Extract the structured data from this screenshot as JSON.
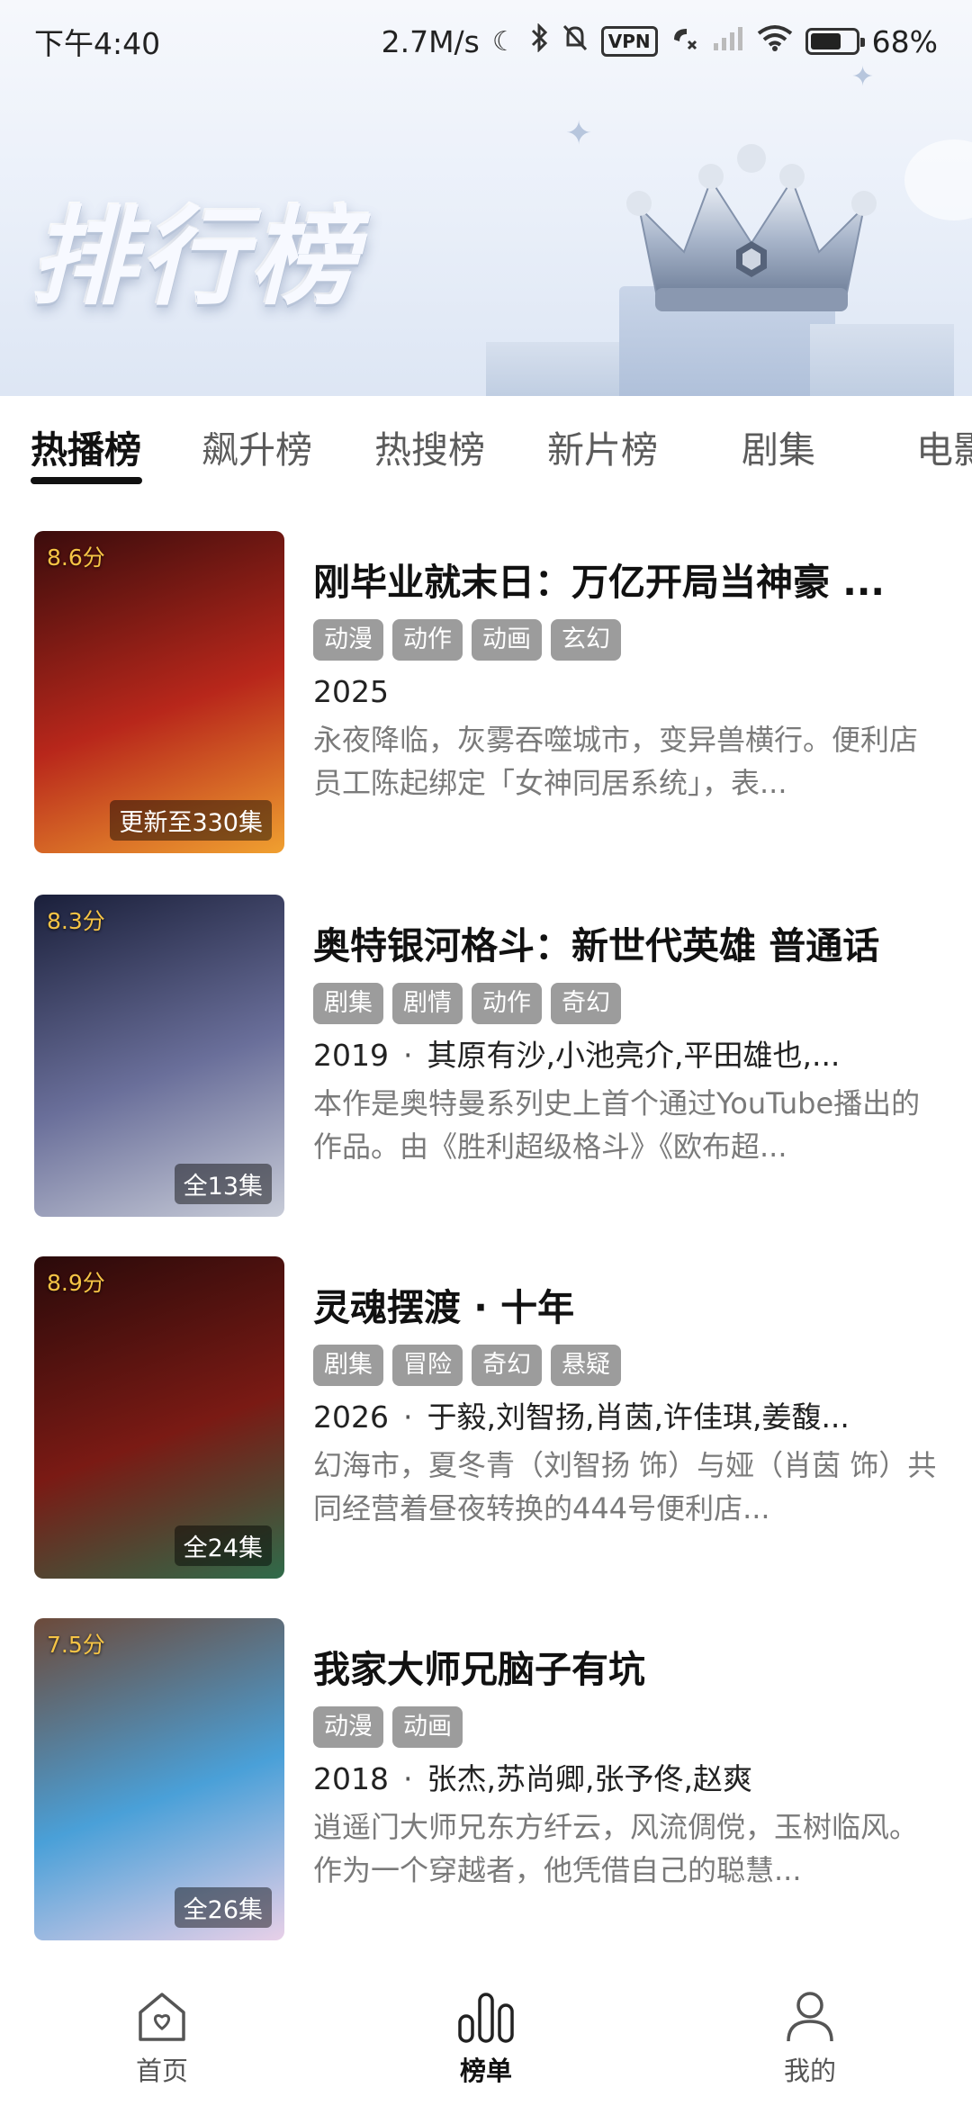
{
  "status_bar": {
    "time": "下午4:40",
    "net_speed": "2.7M/s",
    "vpn": "VPN",
    "battery": "68%",
    "battery_level": 0.68
  },
  "banner": {
    "title": "排行榜"
  },
  "tabs": [
    {
      "label": "热播榜",
      "active": true
    },
    {
      "label": "飙升榜",
      "active": false
    },
    {
      "label": "热搜榜",
      "active": false
    },
    {
      "label": "新片榜",
      "active": false
    },
    {
      "label": "剧集",
      "active": false
    },
    {
      "label": "电影",
      "active": false
    }
  ],
  "items": [
    {
      "rating": "8.6分",
      "episodes": "更新至330集",
      "title": "刚毕业就末日：万亿开局当神豪 ...",
      "tags": [
        "动漫",
        "动作",
        "动画",
        "玄幻"
      ],
      "year": "2025",
      "cast": "",
      "desc": "永夜降临，灰雾吞噬城市，变异兽横行。便利店员工陈起绑定「女神同居系统」，表...",
      "poster_colors": [
        "#3a0c0c",
        "#b8271b",
        "#f0a030"
      ]
    },
    {
      "rating": "8.3分",
      "episodes": "全13集",
      "title": "奥特银河格斗：新世代英雄 普通话",
      "tags": [
        "剧集",
        "剧情",
        "动作",
        "奇幻"
      ],
      "year": "2019",
      "cast": "其原有沙,小池亮介,平田雄也,...",
      "desc": "本作是奥特曼系列史上首个通过YouTube播出的作品。由《胜利超级格斗》《欧布超...",
      "poster_colors": [
        "#1a1f3a",
        "#6a6f9a",
        "#c8ccd8"
      ]
    },
    {
      "rating": "8.9分",
      "episodes": "全24集",
      "title": "灵魂摆渡 · 十年",
      "tags": [
        "剧集",
        "冒险",
        "奇幻",
        "悬疑"
      ],
      "year": "2026",
      "cast": "于毅,刘智扬,肖茵,许佳琪,姜馥...",
      "desc": "幻海市，夏冬青（刘智扬 饰）与娅（肖茵 饰）共同经营着昼夜转换的444号便利店...",
      "poster_colors": [
        "#2a0a0a",
        "#7a1a14",
        "#2f6b4a"
      ]
    },
    {
      "rating": "7.5分",
      "episodes": "全26集",
      "title": "我家大师兄脑子有坑",
      "tags": [
        "动漫",
        "动画"
      ],
      "year": "2018",
      "cast": "张杰,苏尚卿,张予佟,赵爽",
      "desc": "逍遥门大师兄东方纤云，风流倜傥，玉树临风。作为一个穿越者，他凭借自己的聪慧...",
      "poster_colors": [
        "#6c4a3a",
        "#4aa0d8",
        "#e8d0e8"
      ]
    }
  ],
  "bottom_nav": [
    {
      "label": "首页",
      "icon": "home-icon",
      "active": false
    },
    {
      "label": "榜单",
      "icon": "chart-bars-icon",
      "active": true
    },
    {
      "label": "我的",
      "icon": "person-icon",
      "active": false
    }
  ]
}
